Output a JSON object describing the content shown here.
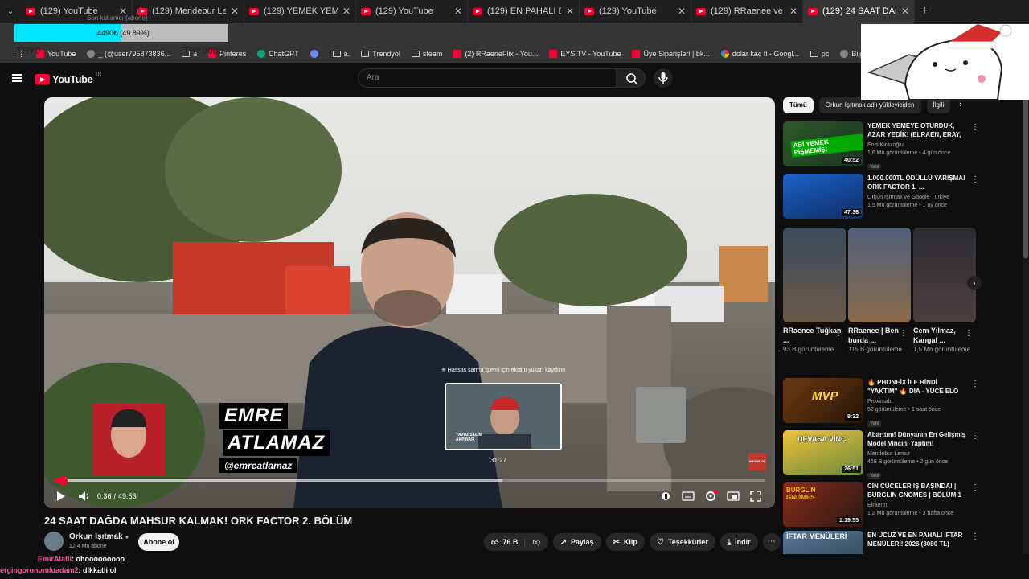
{
  "browser": {
    "tabs": [
      {
        "title": "(129) YouTube",
        "active": false
      },
      {
        "title": "(129) Mendebur Lemur - Y",
        "active": false
      },
      {
        "title": "(129) YEMEK YEMEYE OTU",
        "active": false
      },
      {
        "title": "(129) YouTube",
        "active": false
      },
      {
        "title": "(129) EN PAHALI DEV MA",
        "active": false
      },
      {
        "title": "(129) YouTube",
        "active": false
      },
      {
        "title": "(129) RRaenee ve Başak C",
        "active": false
      },
      {
        "title": "(129) 24 SAAT DAĞDA MA",
        "active": true
      }
    ],
    "new_tab": "+",
    "bookmarks": [
      {
        "label": "YouTube",
        "icon": "red"
      },
      {
        "label": "_ (@user795873836...",
        "icon": "grey"
      },
      {
        "label": "a",
        "icon": "folder"
      },
      {
        "label": "Pinteres",
        "icon": "red"
      },
      {
        "label": "ChatGPT",
        "icon": "green"
      },
      {
        "label": "",
        "icon": "blue"
      },
      {
        "label": "a.",
        "icon": "folder"
      },
      {
        "label": "Trendyol",
        "icon": "folder"
      },
      {
        "label": "steam",
        "icon": "folder"
      },
      {
        "label": "(2) RRaeneFlix - You...",
        "icon": "red"
      },
      {
        "label": "EYS TV - YouTube",
        "icon": "red"
      },
      {
        "label": "Üye Siparişleri | bk...",
        "icon": "red"
      },
      {
        "label": "dolar kaç tl - Googl...",
        "icon": "goog"
      },
      {
        "label": "pc",
        "icon": "folder"
      },
      {
        "label": "Bilgisayarlı",
        "icon": "grey"
      },
      {
        "label": "ORİJİNAL",
        "icon": "grey"
      }
    ]
  },
  "overlay": {
    "goal_top_text": "Son kullanıcı (abone)",
    "goal_progress": 0.4989,
    "goal_text": "4490₺ (49.89%)",
    "try_left": "TRY0",
    "try_right": "TRY9000"
  },
  "youtube": {
    "logo": "YouTube",
    "region": "TR",
    "search_placeholder": "Ara"
  },
  "player": {
    "time_current": "0:36",
    "time_total": "49:53",
    "progress_fraction": 0.012,
    "hover_fraction": 0.63,
    "preview_hint": "※ Hassas sarma işlemi için ekranı yukarı kaydırın",
    "preview_time": "31:27",
    "preview_name": "YAVUZ SELİM AKPINAR",
    "lower_third_line1": "EMRE",
    "lower_third_line2": "ATLAMAZ",
    "lower_third_handle": "@emreatlamaz",
    "corner_badge": "ABONE OL"
  },
  "video": {
    "title": "24 SAAT DAĞDA MAHSUR KALMAK! ORK FACTOR 2. BÖLÜM",
    "owner": "Orkun Işıtmak",
    "subs": "12,4 Mn abone",
    "subscribe": "Abone ol",
    "likes": "76 B",
    "share": "Paylaş",
    "clip": "Klip",
    "thanks": "Teşekkürler",
    "download": "İndir"
  },
  "chat": [
    {
      "user": "EmirAlatli",
      "message": "ohooooooooo"
    },
    {
      "user": "ergingorunumluadam2",
      "message": "dikkatli ol"
    }
  ],
  "sidebar": {
    "chips": [
      "Tümü",
      "Orkun Işıtmak adlı yükleyiciden",
      "İlgili"
    ],
    "videos_top": [
      {
        "title": "YEMEK YEMEYE OTURDUK, AZAR YEDİK! (ELRAEN, ERAY, ...",
        "channel": "Enis Kirazoğlu",
        "views": "1,6 Mn görüntüleme • 4 gün önce",
        "badge": "Yeni",
        "duration": "40:52",
        "thumb_text": "ABİ YEMEK PİŞMEMİŞ!"
      },
      {
        "title": "1.000.000TL ÖDÜLLÜ YARIŞMA! ORK FACTOR 1. ...",
        "channel": "Orkun Işıtmak ve Google Türkiye",
        "views": "1,5 Mn görüntüleme • 1 ay önce",
        "badge": "",
        "duration": "47:36",
        "thumb_text": ""
      }
    ],
    "shorts": [
      {
        "title": "RRaenee Tuğkan ...",
        "views": "93 B görüntüleme"
      },
      {
        "title": "RRaenee | Ben burda ...",
        "views": "115 B görüntüleme"
      },
      {
        "title": "Cem Yılmaz, Kangal ...",
        "views": "1,5 Mn görüntüleme"
      }
    ],
    "videos_bottom": [
      {
        "title": "🔥 PHONEİX İLE BİNDİ \"YAKTIM\" 🔥 DİA - YÜCE ELO",
        "channel": "Proximabt",
        "views": "52 görüntüleme • 1 saat önce",
        "badge": "Yeni",
        "duration": "9:32",
        "thumb_text": "MVP"
      },
      {
        "title": "Abarttım! Dünyanın En Gelişmiş Model Vincini Yaptım!",
        "channel": "Mendebur Lemur",
        "views": "468 B görüntüleme • 2 gün önce",
        "badge": "Yeni",
        "duration": "26:51",
        "thumb_text": "DEVASA VİNÇ"
      },
      {
        "title": "CİN CÜCELER İŞ BAŞINDA! | BURGLIN GNOMES | BÖLÜM 1",
        "channel": "Elraenn",
        "views": "1,2 Mn görüntüleme • 3 hafta önce",
        "badge": "",
        "duration": "1:19:55",
        "thumb_text": "BURGLIN GNOMES"
      },
      {
        "title": "EN UCUZ VE EN PAHALI İFTAR MENÜLERİ! 2026 (3080 TL)",
        "channel": "",
        "views": "",
        "badge": "",
        "duration": "",
        "thumb_text": "İFTAR MENÜLERİ"
      }
    ]
  },
  "colors": {
    "accent": "#ff0033",
    "bg": "#0f0f0f",
    "chip": "#272727",
    "goal": "#00e5ff"
  }
}
